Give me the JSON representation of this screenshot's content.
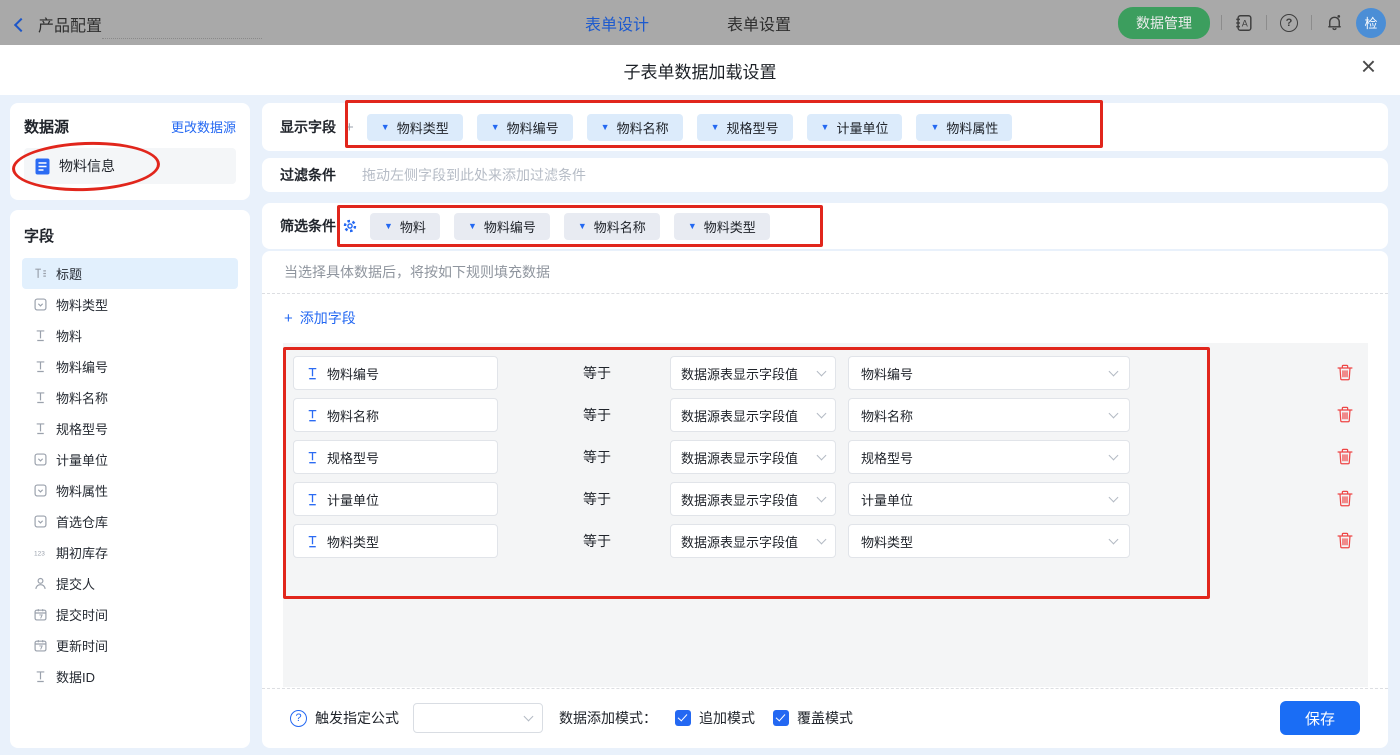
{
  "topbar": {
    "back_label": "产品配置",
    "tabs": [
      {
        "label": "表单设计",
        "active": true
      },
      {
        "label": "表单设置",
        "active": false
      }
    ],
    "data_manage_label": "数据管理",
    "avatar_text": "检"
  },
  "modal": {
    "title": "子表单数据加载设置"
  },
  "sidebar": {
    "datasource": {
      "title": "数据源",
      "change_link": "更改数据源",
      "item": "物料信息"
    },
    "fields": {
      "title": "字段",
      "items": [
        {
          "label": "标题",
          "icon": "title-icon",
          "selected": true
        },
        {
          "label": "物料类型",
          "icon": "select-icon",
          "selected": false
        },
        {
          "label": "物料",
          "icon": "text-icon",
          "selected": false
        },
        {
          "label": "物料编号",
          "icon": "text-icon",
          "selected": false
        },
        {
          "label": "物料名称",
          "icon": "text-icon",
          "selected": false
        },
        {
          "label": "规格型号",
          "icon": "text-icon",
          "selected": false
        },
        {
          "label": "计量单位",
          "icon": "select-icon",
          "selected": false
        },
        {
          "label": "物料属性",
          "icon": "select-icon",
          "selected": false
        },
        {
          "label": "首选仓库",
          "icon": "select-icon",
          "selected": false
        },
        {
          "label": "期初库存",
          "icon": "number-icon",
          "selected": false
        },
        {
          "label": "提交人",
          "icon": "user-icon",
          "selected": false
        },
        {
          "label": "提交时间",
          "icon": "date-icon",
          "selected": false
        },
        {
          "label": "更新时间",
          "icon": "date-icon",
          "selected": false
        },
        {
          "label": "数据ID",
          "icon": "text-icon",
          "selected": false
        }
      ]
    }
  },
  "display_fields": {
    "label": "显示字段",
    "tags": [
      "物料类型",
      "物料编号",
      "物料名称",
      "规格型号",
      "计量单位",
      "物料属性"
    ]
  },
  "filter": {
    "label": "过滤条件",
    "placeholder": "拖动左侧字段到此处来添加过滤条件"
  },
  "screen_filter": {
    "label": "筛选条件",
    "tags": [
      "物料",
      "物料编号",
      "物料名称",
      "物料类型"
    ]
  },
  "rules": {
    "hint": "当选择具体数据后，将按如下规则填充数据",
    "add_field_label": "添加字段",
    "equals_label": "等于",
    "rows": [
      {
        "field": "物料编号",
        "source": "数据源表显示字段值",
        "value": "物料编号"
      },
      {
        "field": "物料名称",
        "source": "数据源表显示字段值",
        "value": "物料名称"
      },
      {
        "field": "规格型号",
        "source": "数据源表显示字段值",
        "value": "规格型号"
      },
      {
        "field": "计量单位",
        "source": "数据源表显示字段值",
        "value": "计量单位"
      },
      {
        "field": "物料类型",
        "source": "数据源表显示字段值",
        "value": "物料类型"
      }
    ]
  },
  "footer": {
    "formula_label": "触发指定公式",
    "formula_value": "",
    "mode_label": "数据添加模式：",
    "checkboxes": [
      {
        "label": "追加模式",
        "checked": true
      },
      {
        "label": "覆盖模式",
        "checked": true
      }
    ],
    "save_label": "保存"
  },
  "colors": {
    "accent_blue": "#2468f2",
    "save_blue": "#1a6df5",
    "annotation_red": "#e1261c",
    "data_manage_green": "#3c9e5e",
    "modal_background": "#e9f1fb"
  }
}
